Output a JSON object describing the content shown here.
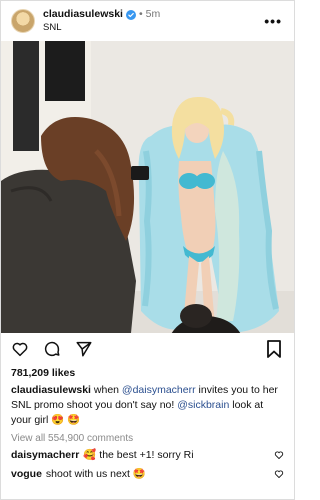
{
  "post": {
    "username": "claudiasulewski",
    "separator": "•",
    "time": "5m",
    "location": "SNL",
    "more_label": "•••"
  },
  "icons": {
    "verified": "verified-badge-icon",
    "like": "heart-icon",
    "comment": "comment-icon",
    "share": "send-icon",
    "save": "bookmark-icon"
  },
  "likes": "781,209 likes",
  "caption": {
    "username": "claudiasulewski",
    "part1": "when",
    "mention1": "@daisymacherr",
    "part2": "invites you to her SNL promo shoot you don't say no!",
    "mention2": "@sickbrain",
    "part3": "look at your girl 😍 🤩"
  },
  "view_all": "View all 554,900 comments",
  "comments": [
    {
      "username": "daisymacherr",
      "text": "🥰 the best +1! sorry Ri"
    },
    {
      "username": "vogue",
      "text": "shoot with us next 🤩"
    }
  ],
  "colors": {
    "verified": "#3897f0",
    "link": "#2b4f8f",
    "muted": "#8a8a8a"
  }
}
